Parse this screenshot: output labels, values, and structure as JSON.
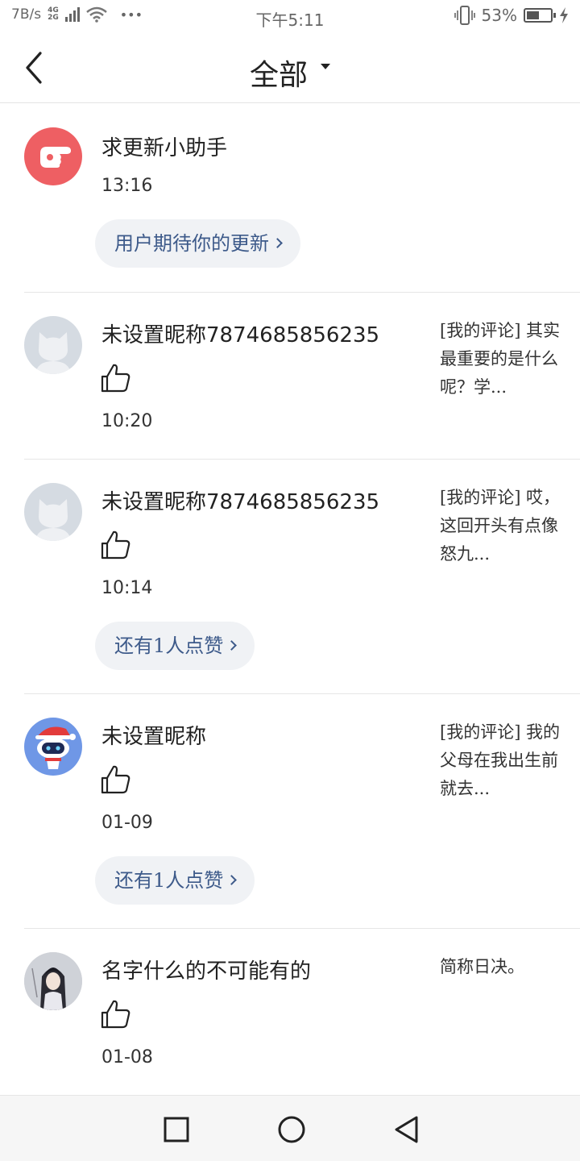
{
  "status_bar": {
    "net_speed": "7B/s",
    "gen_top": "4G",
    "gen_bottom": "2G",
    "more": "•••",
    "time": "下午5:11",
    "battery": "53%",
    "battery_level": 0.53
  },
  "header": {
    "title": "全部"
  },
  "items": [
    {
      "name": "求更新小助手",
      "time": "13:16",
      "pill": "用户期待你的更新",
      "avatar": "pointing-hand-icon"
    },
    {
      "name": "未设置昵称7874685856235",
      "time": "10:20",
      "comment": "[我的评论] 其实最重要的是什么呢？学...",
      "avatar": "default-cat-avatar"
    },
    {
      "name": "未设置昵称7874685856235",
      "time": "10:14",
      "comment": "[我的评论] 哎，这回开头有点像怒九...",
      "pill": "还有1人点赞",
      "avatar": "default-cat-avatar"
    },
    {
      "name": "未设置昵称",
      "time": "01-09",
      "comment": "[我的评论] 我的父母在我出生前就去...",
      "pill": "还有1人点赞",
      "avatar": "robot-santa-avatar"
    },
    {
      "name": "名字什么的不可能有的",
      "time": "01-08",
      "comment": "简称日决。",
      "avatar": "anime-character-avatar"
    }
  ],
  "colors": {
    "accent": "#3d5a8a",
    "pill_bg": "#f0f2f5",
    "helper_avatar": "#ee5f63"
  }
}
